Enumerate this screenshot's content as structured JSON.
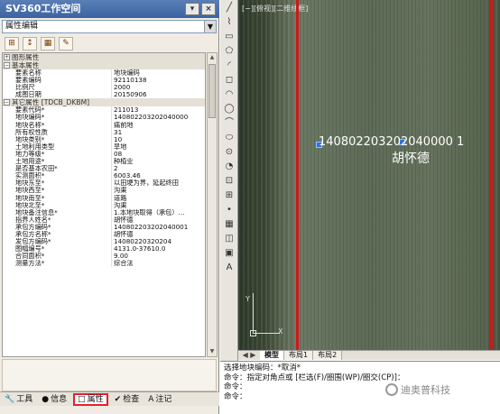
{
  "window": {
    "title": "SV360工作空间",
    "buttons": [
      "▾",
      "×"
    ]
  },
  "combo": {
    "value": "属性编辑"
  },
  "toolbar_icons": [
    "expand-icon",
    "sort-icon",
    "table-icon",
    "brush-icon"
  ],
  "toolbar_glyphs": [
    "⊞",
    "↕",
    "▦",
    "✎"
  ],
  "property_grid": {
    "rows": [
      {
        "type": "cat",
        "label": "图形属性",
        "exp": "+"
      },
      {
        "type": "cat",
        "label": "基本属性",
        "exp": "−"
      },
      {
        "type": "row",
        "k": "要素名称",
        "v": "地块编码"
      },
      {
        "type": "row",
        "k": "要素编码",
        "v": "92110138"
      },
      {
        "type": "row",
        "k": "比例尺",
        "v": "2000"
      },
      {
        "type": "row",
        "k": "成图日期",
        "v": "20150906"
      },
      {
        "type": "cat",
        "label": "其它属性 [TDCB_DKBM]",
        "exp": "−"
      },
      {
        "type": "row",
        "k": "要素代码*",
        "v": "211013"
      },
      {
        "type": "row",
        "k": "地块编码*",
        "v": "140802203202040000"
      },
      {
        "type": "row",
        "k": "地块名称*",
        "v": "痛前地"
      },
      {
        "type": "row",
        "k": "所有权性质",
        "v": "31"
      },
      {
        "type": "row",
        "k": "地块类别*",
        "v": "10"
      },
      {
        "type": "row",
        "k": "土地利用类型",
        "v": "旱地"
      },
      {
        "type": "row",
        "k": "地力等级*",
        "v": "08"
      },
      {
        "type": "row",
        "k": "土地用途*",
        "v": "种植业"
      },
      {
        "type": "row",
        "k": "是否基本农田*",
        "v": "2"
      },
      {
        "type": "row",
        "k": "实测面积*",
        "v": "6003.46"
      },
      {
        "type": "row",
        "k": "地块东至*",
        "v": "以田埂为界，延起终田"
      },
      {
        "type": "row",
        "k": "地块西至*",
        "v": "沟渠"
      },
      {
        "type": "row",
        "k": "地块南至*",
        "v": "道路"
      },
      {
        "type": "row",
        "k": "地块北至*",
        "v": "沟渠"
      },
      {
        "type": "row",
        "k": "地块备注信息*",
        "v": "1.本地块取得（承包）..."
      },
      {
        "type": "row",
        "k": "指界人姓名*",
        "v": "胡怀德"
      },
      {
        "type": "row",
        "k": "承包方编码*",
        "v": "140802203202040001"
      },
      {
        "type": "row",
        "k": "承包方名称*",
        "v": "胡怀德"
      },
      {
        "type": "row",
        "k": "发包方编码*",
        "v": "14080220320204"
      },
      {
        "type": "row",
        "k": "图幅编号*",
        "v": "4131.0-37610.0"
      },
      {
        "type": "row",
        "k": "合同面积*",
        "v": "9.00"
      },
      {
        "type": "row",
        "k": "测量方法*",
        "v": "综合法"
      }
    ]
  },
  "bottom_tabs": [
    {
      "label": "工具",
      "icon": "🔧",
      "name": "tab-tools",
      "active": false
    },
    {
      "label": "信息",
      "icon": "●",
      "name": "tab-info",
      "active": false
    },
    {
      "label": "属性",
      "icon": "□",
      "name": "tab-properties",
      "active": true
    },
    {
      "label": "检查",
      "icon": "✔",
      "name": "tab-check",
      "active": false
    },
    {
      "label": "注记",
      "icon": "A",
      "name": "tab-annotation",
      "active": false
    }
  ],
  "viewport": {
    "label": "[−][俯视][二维线框]",
    "parcel_code": "140802203202040000 1",
    "owner": "胡怀德",
    "ucs_y": "Y",
    "ucs_x": "X"
  },
  "draw_tools": [
    "╱",
    "⌇",
    "▭",
    "⬠",
    "◜",
    "◻",
    "◠",
    "◯",
    "⌒",
    "⬭",
    "⊙",
    "◔",
    "⊡",
    "⊞",
    "•",
    "▦",
    "◫",
    "▣",
    "A"
  ],
  "layout_tabs": {
    "nav": "◀ ▶",
    "tabs": [
      "模型",
      "布局1",
      "布局2"
    ],
    "active": "模型"
  },
  "command": {
    "lines": [
      "选择地块编码：*取消*",
      "命令：指定对角点或 [栏选(F)/圈围(WP)/圈交(CP)]：",
      "命令：",
      "命令："
    ]
  },
  "watermark": {
    "text": "迪奥普科技"
  }
}
